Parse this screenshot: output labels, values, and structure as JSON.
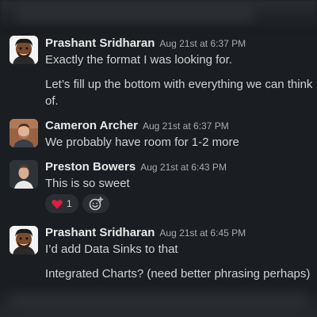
{
  "messages": [
    {
      "author": "Prashant Sridharan",
      "timestamp": "Aug 21st at 6:37 PM",
      "lines": [
        "Exactly the format I was looking for.",
        "Let’s fill up the bottom with everything we can think",
        "of."
      ]
    },
    {
      "author": "Cameron Archer",
      "timestamp": "Aug 21st at 6:37 PM",
      "lines": [
        "We probably have room for 1-2 more"
      ]
    },
    {
      "author": "Preston Bowers",
      "timestamp": "Aug 21st at 6:43 PM",
      "lines": [
        "This is so sweet"
      ],
      "reaction": {
        "emoji": "heart",
        "count": "1"
      }
    },
    {
      "author": "Prashant Sridharan",
      "timestamp": "Aug 21st at 6:45 PM",
      "lines": [
        "I’d add Data Sinks to that",
        "Integrated Charts? (need better phrasing perhaps)"
      ]
    }
  ],
  "colors": {
    "background": "#1a1d21",
    "name": "#e8e8e8",
    "text": "#d1d2d3",
    "timestamp": "#ababad",
    "reaction_bg": "#2b2e33",
    "heart": "#e01e3c"
  }
}
